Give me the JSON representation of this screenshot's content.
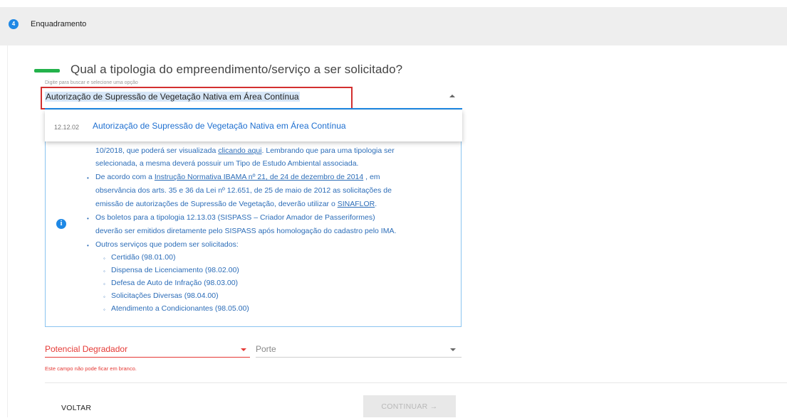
{
  "step": {
    "number": "4",
    "title": "Enquadramento"
  },
  "question": "Qual a tipologia do empreendimento/serviço a ser solicitado?",
  "select": {
    "hint": "Digite para buscar e selecione uma opção",
    "value": "Autorização de Supressão de Vegetação Nativa em Área Contínua"
  },
  "dropdown": {
    "options": [
      {
        "code": "12.12.02",
        "label": "Autorização de Supressão de Vegetação Nativa em Área Contínua"
      }
    ]
  },
  "info": {
    "icon": "info-icon",
    "l1a": "10/2018, que poderá ser visualizada ",
    "l1b": "clicando aqui",
    "l1c": ". Lembrando que para uma tipologia ser",
    "l2": "selecionada, a mesma deverá possuir um Tipo de Estudo Ambiental associada.",
    "l3a": "De acordo com a ",
    "l3b": "Instrução Normativa IBAMA nº 21, de 24 de dezembro de 2014",
    "l3c": " , em",
    "l4": "observância dos arts. 35 e 36 da Lei nº 12.651, de 25 de maio de 2012 as solicitações de",
    "l5a": "emissão de autorizações de Supressão de Vegetação, deverão utilizar o ",
    "l5b": "SINAFLOR",
    "l5c": ".",
    "l6": "Os boletos para a tipologia 12.13.03 (SISPASS – Criador Amador de Passeriformes)",
    "l7": "deverão ser emitidos diretamente pelo SISPASS após homologação do cadastro pelo IMA.",
    "l8": "Outros serviços que podem ser solicitados:",
    "services": [
      "Certidão (98.01.00)",
      "Dispensa de Licenciamento (98.02.00)",
      "Defesa de Auto de Infração (98.03.00)",
      "Solicitações Diversas (98.04.00)",
      "Atendimento a Condicionantes (98.05.00)"
    ]
  },
  "fields": {
    "potencial_label": "Potencial Degradador",
    "potencial_error": "Este campo não pode ficar em branco.",
    "porte_label": "Porte"
  },
  "buttons": {
    "back": "VOLTAR",
    "continue": "CONTINUAR →"
  },
  "colors": {
    "accent": "#1e88e5",
    "error": "#e53935",
    "question_bar": "#23b24b",
    "highlight_box": "#d32f2f"
  }
}
